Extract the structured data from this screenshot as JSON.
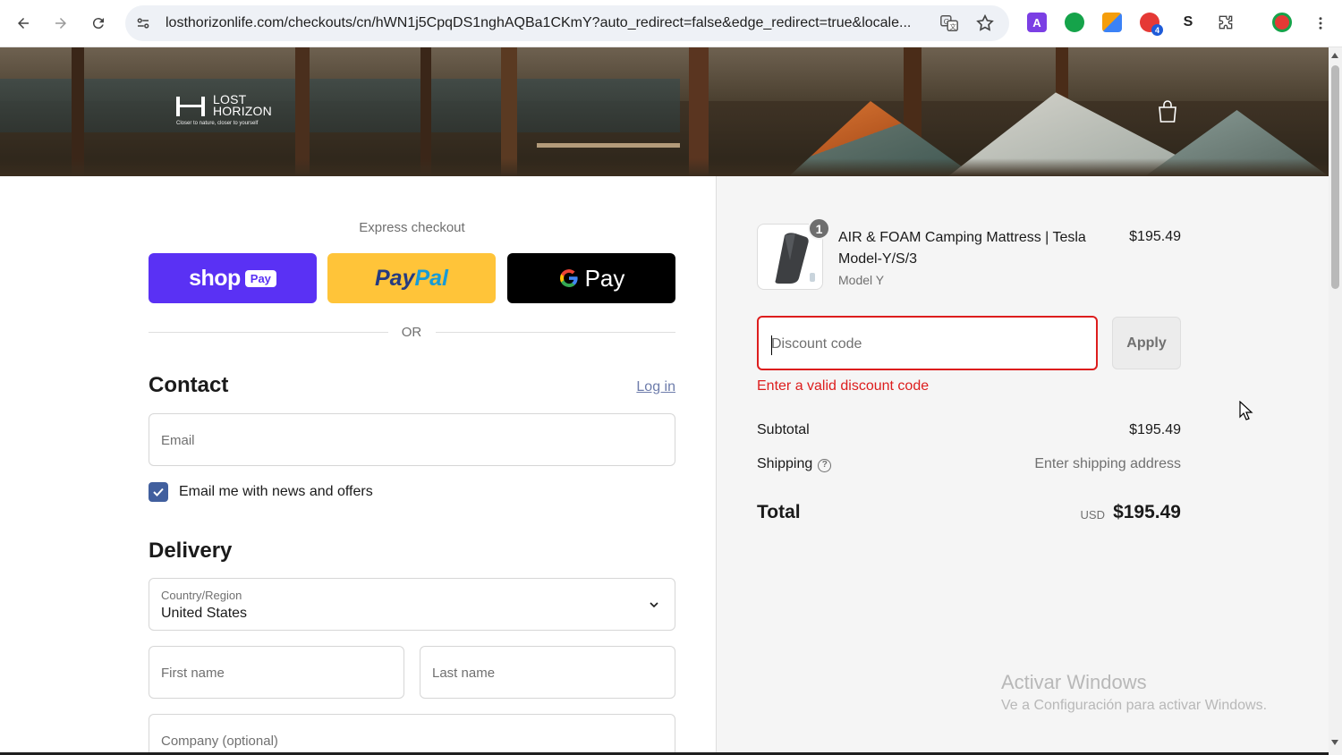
{
  "browser": {
    "url": "losthorizonlife.com/checkouts/cn/hWN1j5CpqDS1nghAQBa1CKmY?auto_redirect=false&edge_redirect=true&locale...",
    "extensions": [
      {
        "icon": "a-extension-icon",
        "label": "A",
        "color": "#7b3fe4"
      },
      {
        "icon": "grammarly-icon",
        "label": "",
        "color": "#15a34a"
      },
      {
        "icon": "grid-extension-icon",
        "label": "",
        "color": "#3b82f6"
      },
      {
        "icon": "red-extension-icon",
        "label": "4",
        "color": "#e53935"
      },
      {
        "icon": "s-extension-icon",
        "label": "S",
        "color": "#222222"
      }
    ]
  },
  "header": {
    "logo_line1": "LOST",
    "logo_line2": "HORIZON",
    "logo_tagline": "Closer to nature, closer to yourself"
  },
  "express": {
    "title": "Express checkout",
    "shop_word": "shop",
    "shop_pay": "Pay",
    "paypal_a": "Pay",
    "paypal_b": "Pal",
    "gpay": "Pay",
    "or": "OR"
  },
  "contact": {
    "heading": "Contact",
    "login": "Log in",
    "email_placeholder": "Email",
    "newsletter_label": "Email me with news and offers",
    "newsletter_checked": true
  },
  "delivery": {
    "heading": "Delivery",
    "country_label": "Country/Region",
    "country_value": "United States",
    "first_name_placeholder": "First name",
    "last_name_placeholder": "Last name",
    "company_placeholder": "Company (optional)"
  },
  "summary": {
    "item": {
      "quantity": "1",
      "name": "AIR & FOAM Camping Mattress | Tesla Model-Y/S/3",
      "variant": "Model Y",
      "price": "$195.49"
    },
    "discount_placeholder": "Discount code",
    "apply": "Apply",
    "error": "Enter a valid discount code",
    "subtotal_label": "Subtotal",
    "subtotal_value": "$195.49",
    "shipping_label": "Shipping",
    "shipping_value": "Enter shipping address",
    "total_label": "Total",
    "total_currency": "USD",
    "total_value": "$195.49"
  },
  "watermark": {
    "line1": "Activar Windows",
    "line2": "Ve a Configuración para activar Windows."
  },
  "colors": {
    "shop_pay": "#5a31f4",
    "paypal": "#ffc439",
    "gpay": "#000000",
    "error": "#dd1d1d",
    "link": "#6d7cab",
    "checkbox": "#415f9e"
  }
}
